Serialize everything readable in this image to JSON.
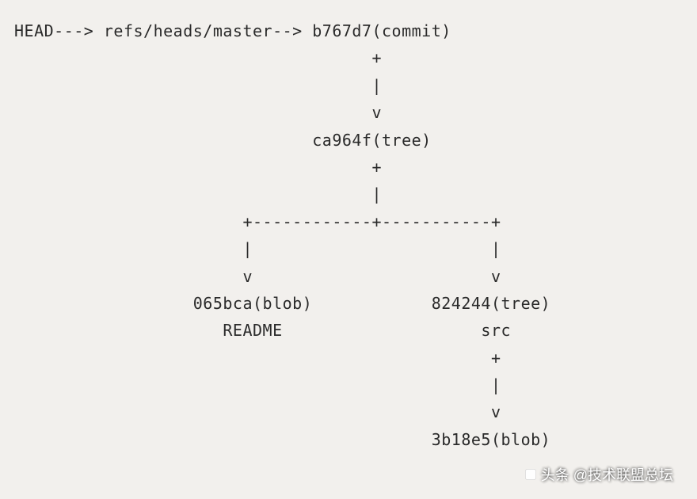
{
  "diagram": {
    "lines": [
      "HEAD---> refs/heads/master--> b767d7(commit)",
      "                                    +",
      "                                    |",
      "                                    v",
      "                              ca964f(tree)",
      "                                    +",
      "                                    |",
      "                       +------------+-----------+",
      "                       |                        |",
      "                       v                        v",
      "                  065bca(blob)            824244(tree)",
      "                     README                    src",
      "                                                +",
      "                                                |",
      "                                                v",
      "                                          3b18e5(blob)"
    ]
  },
  "watermark": {
    "text": "头条 @技术联盟总坛"
  },
  "git_objects": {
    "head": "HEAD",
    "branch_ref": "refs/heads/master",
    "commit": {
      "hash": "b767d7",
      "type": "commit"
    },
    "root_tree": {
      "hash": "ca964f",
      "type": "tree"
    },
    "children": [
      {
        "hash": "065bca",
        "type": "blob",
        "name": "README"
      },
      {
        "hash": "824244",
        "type": "tree",
        "name": "src",
        "children": [
          {
            "hash": "3b18e5",
            "type": "blob"
          }
        ]
      }
    ]
  }
}
